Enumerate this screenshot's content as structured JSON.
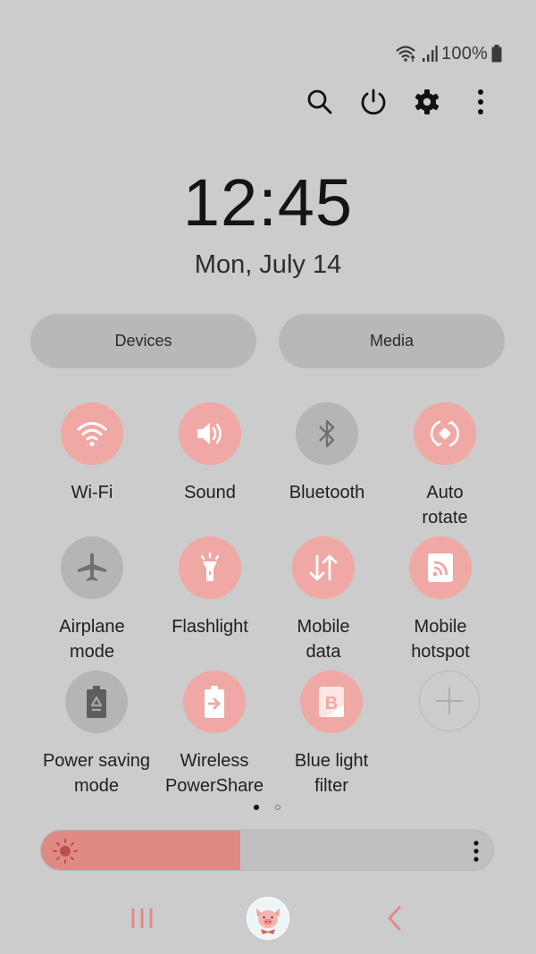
{
  "status_bar": {
    "wifi_icon": "wifi-calling-icon",
    "signal_icon": "cell-signal-icon",
    "battery_percent": "100%",
    "battery_icon": "battery-full-icon"
  },
  "top_actions": [
    {
      "name": "search",
      "icon": "search-icon"
    },
    {
      "name": "power",
      "icon": "power-icon"
    },
    {
      "name": "settings",
      "icon": "gear-icon"
    },
    {
      "name": "more-options",
      "icon": "more-vertical-icon"
    }
  ],
  "clock": {
    "time": "12:45",
    "date": "Mon, July 14"
  },
  "panels": {
    "devices_label": "Devices",
    "media_label": "Media"
  },
  "colors": {
    "accent_on": "#f0a8a4",
    "tile_off": "#b5b5b5",
    "brightness_fill": "#e08a85",
    "nav_accent": "#e38a86",
    "background": "#cccccc"
  },
  "quick_tiles": [
    {
      "label": "Wi-Fi",
      "icon": "wifi-icon",
      "state": "on"
    },
    {
      "label": "Sound",
      "icon": "sound-icon",
      "state": "on"
    },
    {
      "label": "Bluetooth",
      "icon": "bluetooth-icon",
      "state": "off"
    },
    {
      "label": "Auto\nrotate",
      "icon": "auto-rotate-icon",
      "state": "on"
    },
    {
      "label": "Airplane\nmode",
      "icon": "airplane-icon",
      "state": "off"
    },
    {
      "label": "Flashlight",
      "icon": "flashlight-icon",
      "state": "on"
    },
    {
      "label": "Mobile\ndata",
      "icon": "mobile-data-icon",
      "state": "on"
    },
    {
      "label": "Mobile\nhotspot",
      "icon": "hotspot-icon",
      "state": "on"
    },
    {
      "label": "Power saving\nmode",
      "icon": "power-saving-icon",
      "state": "off"
    },
    {
      "label": "Wireless\nPowerShare",
      "icon": "wireless-powershare-icon",
      "state": "on"
    },
    {
      "label": "Blue light\nfilter",
      "icon": "blue-light-filter-icon",
      "state": "on"
    },
    {
      "label": "",
      "icon": "add-icon",
      "state": "add"
    }
  ],
  "page_indicator": {
    "current": 1,
    "total": 2
  },
  "brightness": {
    "level_percent": 44,
    "icon": "sun-icon",
    "more_icon": "more-vertical-icon"
  },
  "nav_bar": {
    "recents_icon": "recents-icon",
    "home_icon": "pig-avatar-icon",
    "back_icon": "back-icon"
  }
}
